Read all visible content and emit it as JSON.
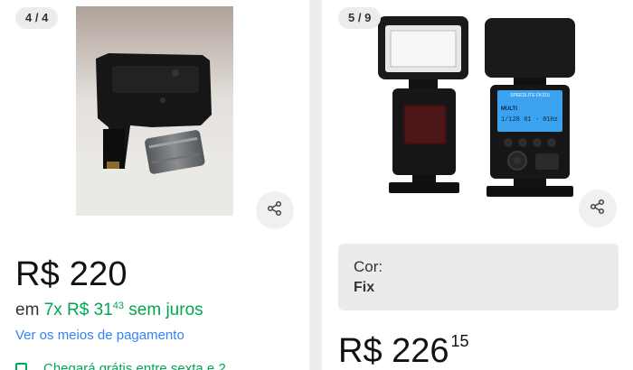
{
  "left_card": {
    "counter": "4 / 4",
    "price": "R$ 220",
    "installments": {
      "prefix": "em",
      "count": "7x",
      "amount": "R$ 31",
      "cents": "43",
      "suffix": "sem juros"
    },
    "payment_link": "Ver os meios de pagamento",
    "shipping_partial": "Chegará grátis entre sexta e 2"
  },
  "right_card": {
    "counter": "5 / 9",
    "flash_brand": "SPEEDLITE FK310",
    "lcd_mode": "MULTI",
    "lcd_text": "1/128 01 - 01Hz",
    "variant": {
      "label": "Cor:",
      "value": "Fix"
    },
    "price": "R$ 226",
    "price_cents": "15"
  },
  "colors": {
    "price_green": "#00a650",
    "link_blue": "#3483fa",
    "lcd_blue": "#3aa2ee"
  },
  "icons": {
    "share": "share-icon"
  }
}
